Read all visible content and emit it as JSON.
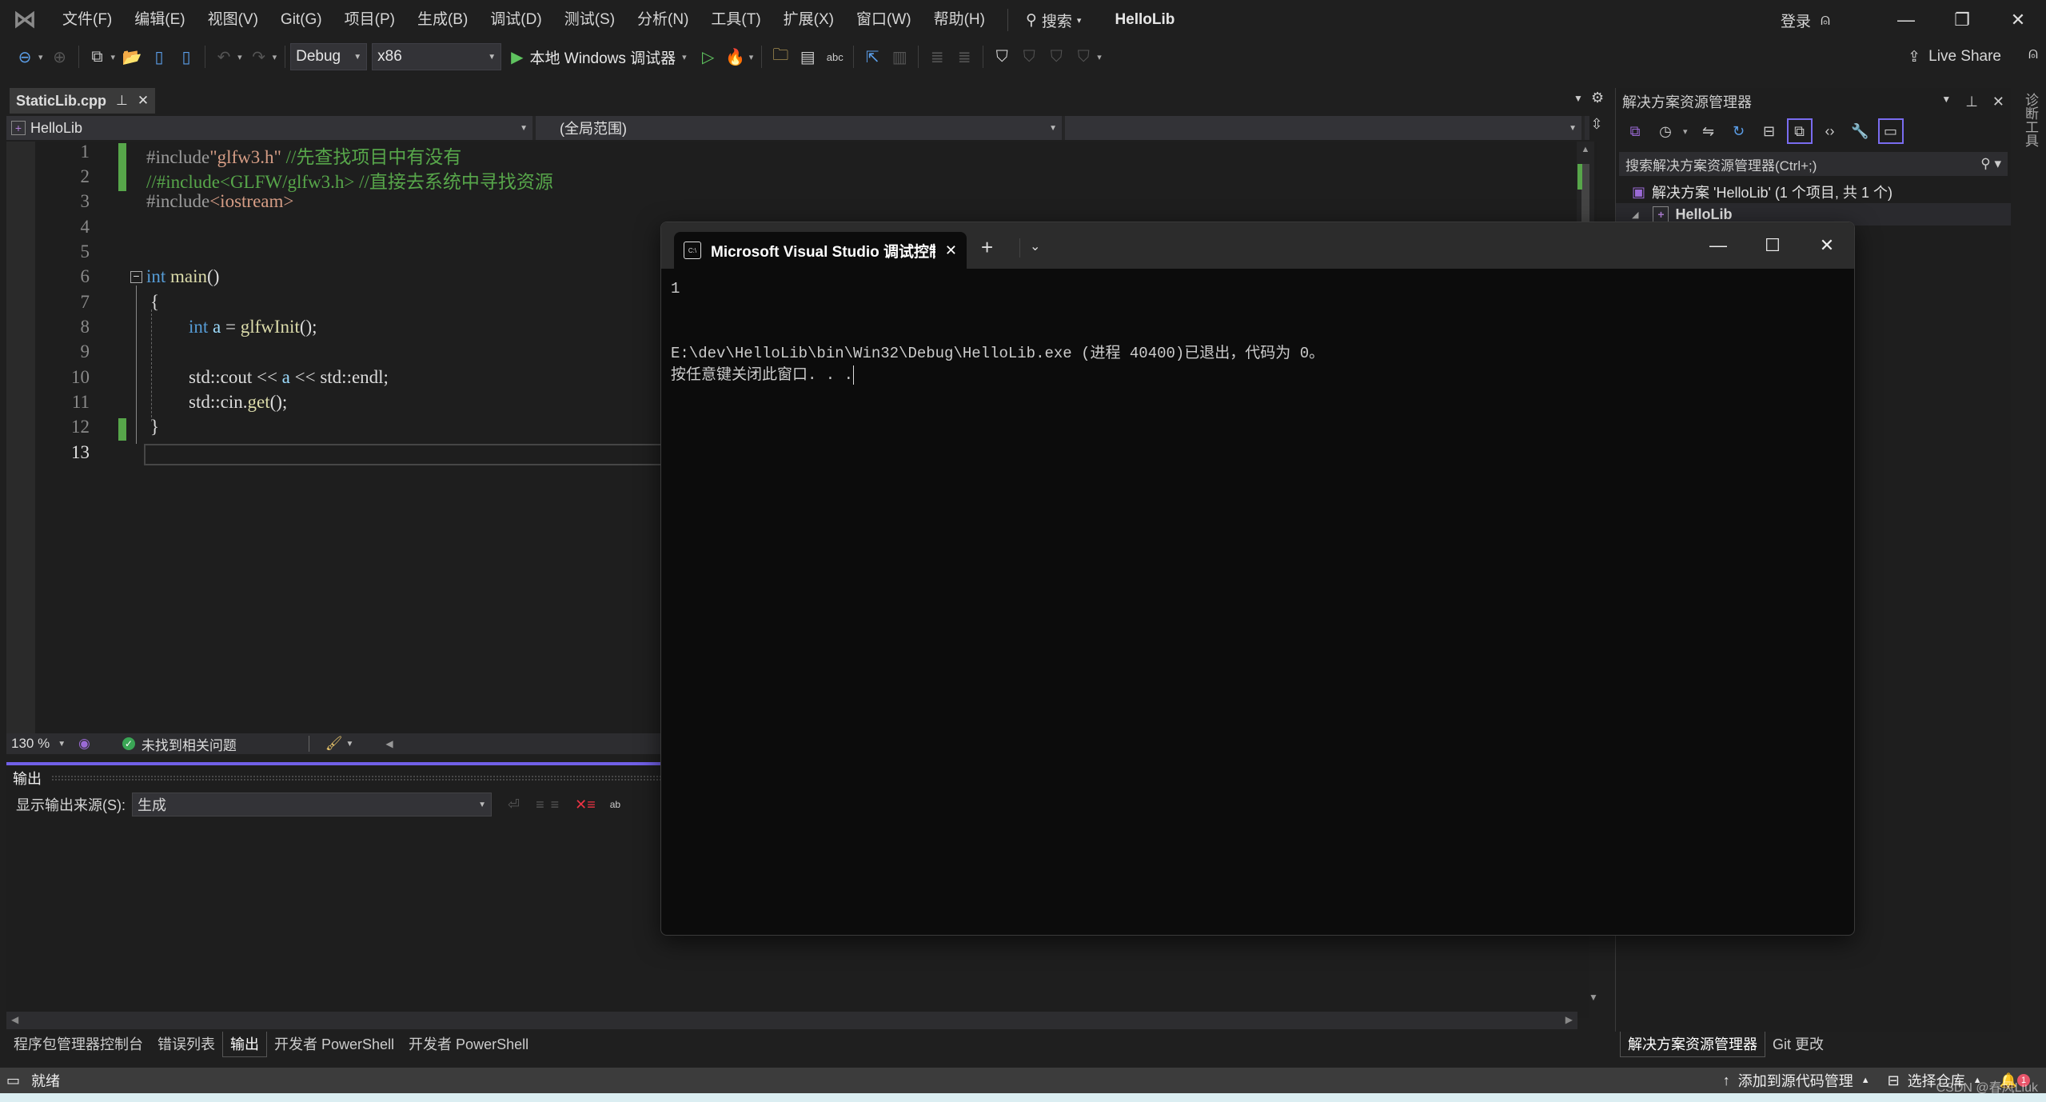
{
  "menubar": {
    "items": [
      "文件(F)",
      "编辑(E)",
      "视图(V)",
      "Git(G)",
      "项目(P)",
      "生成(B)",
      "调试(D)",
      "测试(S)",
      "分析(N)",
      "工具(T)",
      "扩展(X)",
      "窗口(W)",
      "帮助(H)"
    ],
    "search_label": "搜索",
    "solution_name": "HelloLib",
    "login_label": "登录"
  },
  "toolbar": {
    "config": "Debug",
    "platform": "x86",
    "run_label": "本地 Windows 调试器",
    "live_share_label": "Live Share"
  },
  "editor": {
    "tab_label": "StaticLib.cpp",
    "project_combo": "HelloLib",
    "scope_combo": "(全局范围)",
    "member_combo": "",
    "line_numbers": [
      "1",
      "2",
      "3",
      "4",
      "5",
      "6",
      "7",
      "8",
      "9",
      "10",
      "11",
      "12",
      "13"
    ],
    "current_line": "13",
    "lines": {
      "l1_pp": "#include",
      "l1_str": "\"glfw3.h\"",
      "l1_cm": " //先查找项目中有没有",
      "l2_cm": "//#include<GLFW/glfw3.h> //直接去系统中寻找资源",
      "l3_pp": "#include",
      "l3_str": "<iostream>",
      "l6_kw": "int",
      "l6_fn": " main",
      "l6_rest": "()",
      "l7": "{",
      "l8_kw": "int",
      "l8_var": " a",
      "l8_op": " = ",
      "l8_fn": "glfwInit",
      "l8_rest": "();",
      "l10_a": "std::cout << ",
      "l10_var": "a",
      "l10_b": " << std::endl;",
      "l11_a": "std::cin.",
      "l11_fn": "get",
      "l11_b": "();",
      "l12": "}"
    },
    "zoom": "130 %",
    "issues": "未找到相关问题"
  },
  "output": {
    "title": "输出",
    "source_label": "显示输出来源(S):",
    "source_value": "生成"
  },
  "bottom_tabs": [
    "程序包管理器控制台",
    "错误列表",
    "输出",
    "开发者 PowerShell",
    "开发者 PowerShell"
  ],
  "bottom_active": "输出",
  "solution_explorer": {
    "title": "解决方案资源管理器",
    "search_placeholder": "搜索解决方案资源管理器(Ctrl+;)",
    "solution_node": "解决方案 'HelloLib' (1 个项目, 共 1 个)",
    "project_node": "HelloLib",
    "tabs": [
      "解决方案资源管理器",
      "Git 更改"
    ],
    "side_tab": "诊断工具"
  },
  "statusbar": {
    "ready": "就绪",
    "add_source_control": "添加到源代码管理",
    "select_repo": "选择仓库",
    "notifications": "1",
    "watermark": "CSDN @春风Liuk"
  },
  "console": {
    "tab_title": "Microsoft Visual Studio 调试控制台",
    "output_line1": "1",
    "output_line2": "E:\\dev\\HelloLib\\bin\\Win32\\Debug\\HelloLib.exe (进程 40400)已退出，代码为 0。",
    "output_line3": "按任意键关闭此窗口. . ."
  },
  "colors": {
    "accent": "#7160e8",
    "change_marker": "#57a64a",
    "keyword": "#569cd6",
    "function": "#dcdcaa",
    "string": "#d69d85",
    "comment": "#57a64a"
  }
}
